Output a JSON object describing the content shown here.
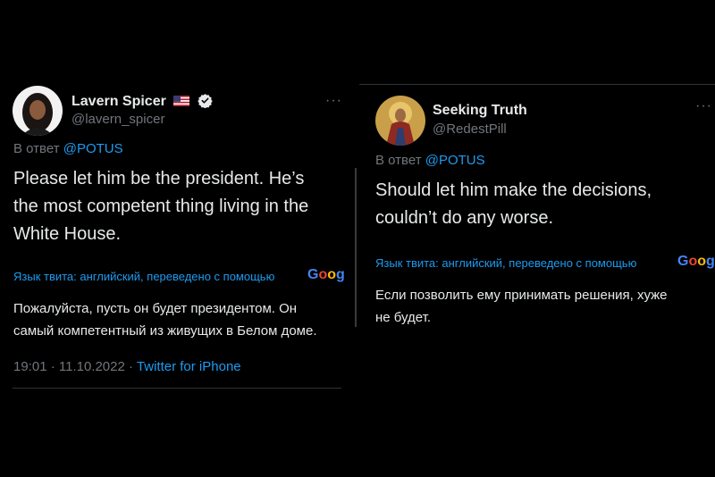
{
  "left": {
    "display_name": "Lavern Spicer",
    "handle": "@lavern_spicer",
    "more": "···",
    "reply_prefix": "В ответ",
    "reply_mention": "@POTUS",
    "tweet_lines": [
      "Please let him be the president. He’s",
      "the most competent thing living in the",
      "White House."
    ],
    "translate_label": "Язык твита: английский, переведено с помощью",
    "google_logo": "Goog",
    "translated_lines": [
      "Пожалуйста, пусть он будет президентом. Он",
      "самый компетентный из живущих в Белом доме."
    ],
    "timestamp": "19:01 · 11.10.2022 ·",
    "source": "Twitter for iPhone"
  },
  "right": {
    "display_name": "Seeking Truth",
    "handle": "@RedestPill",
    "more": "···",
    "reply_prefix": "В ответ",
    "reply_mention": "@POTUS",
    "tweet_lines": [
      "Should let him make the decisions,",
      "couldn’t do any worse."
    ],
    "translate_label": "Язык твита: английский, переведено с помощью",
    "google_logo": "Goog",
    "translated_lines": [
      "Если позволить ему принимать решения, хуже",
      "не будет."
    ]
  },
  "colors": {
    "background": "#000000",
    "text": "#e7e9ea",
    "secondary": "#71767b",
    "link": "#1d9bf0",
    "verified": "#e7e9ea"
  },
  "icons": {
    "flag": "us-flag-icon",
    "verified": "verified-badge-icon",
    "more": "more-options-icon"
  }
}
